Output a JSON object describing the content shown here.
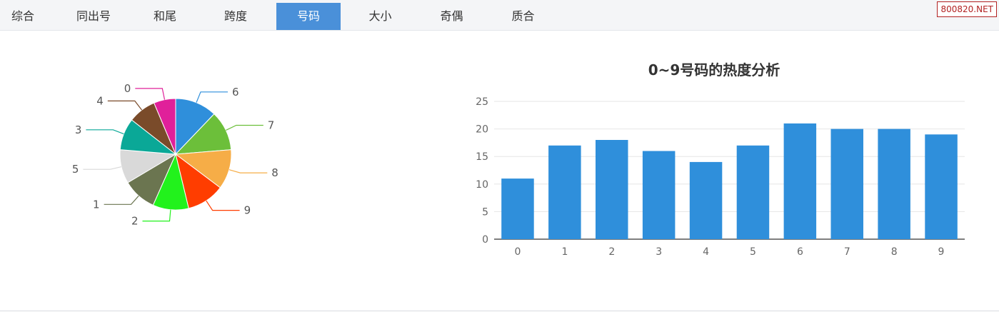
{
  "tabs": [
    {
      "label": "综合",
      "active": false
    },
    {
      "label": "同出号",
      "active": false
    },
    {
      "label": "和尾",
      "active": false
    },
    {
      "label": "跨度",
      "active": false
    },
    {
      "label": "号码",
      "active": true
    },
    {
      "label": "大小",
      "active": false
    },
    {
      "label": "奇偶",
      "active": false
    },
    {
      "label": "质合",
      "active": false
    }
  ],
  "watermark": "800820.NET",
  "chart_data": [
    {
      "type": "pie",
      "title": "",
      "slices": [
        {
          "label": "6",
          "value": 21,
          "color": "#2f8fdb"
        },
        {
          "label": "7",
          "value": 20,
          "color": "#6cbf3a"
        },
        {
          "label": "8",
          "value": 20,
          "color": "#f6ad47"
        },
        {
          "label": "9",
          "value": 19,
          "color": "#ff3d00"
        },
        {
          "label": "2",
          "value": 18,
          "color": "#22f21c"
        },
        {
          "label": "1",
          "value": 17,
          "color": "#6b7550"
        },
        {
          "label": "5",
          "value": 17,
          "color": "#d9d9d9"
        },
        {
          "label": "3",
          "value": 16,
          "color": "#0aa897"
        },
        {
          "label": "4",
          "value": 14,
          "color": "#7a4b2a"
        },
        {
          "label": "0",
          "value": 11,
          "color": "#e0209a"
        }
      ]
    },
    {
      "type": "bar",
      "title": "0~9号码的热度分析",
      "categories": [
        "0",
        "1",
        "2",
        "3",
        "4",
        "5",
        "6",
        "7",
        "8",
        "9"
      ],
      "values": [
        11,
        17,
        18,
        16,
        14,
        17,
        21,
        20,
        20,
        19
      ],
      "ylim": [
        0,
        25
      ],
      "yticks": [
        0,
        5,
        10,
        15,
        20,
        25
      ],
      "color": "#2f8fdb",
      "grid": true
    }
  ]
}
